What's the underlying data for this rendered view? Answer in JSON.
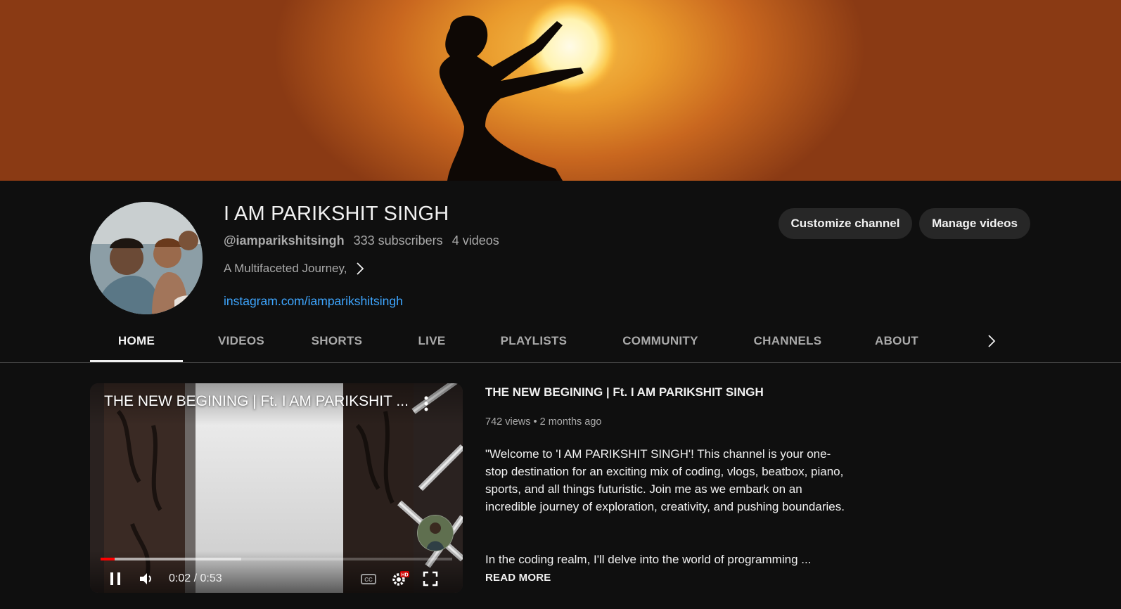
{
  "channel": {
    "name": "I AM PARIKSHIT SINGH",
    "handle": "@iamparikshitsingh",
    "subscribers": "333 subscribers",
    "videos": "4 videos",
    "tagline": "A Multifaceted Journey,",
    "link": "instagram.com/iamparikshitsingh"
  },
  "actions": {
    "customize": "Customize channel",
    "manage": "Manage videos"
  },
  "tabs": [
    {
      "label": "HOME",
      "active": true
    },
    {
      "label": "VIDEOS"
    },
    {
      "label": "SHORTS"
    },
    {
      "label": "LIVE"
    },
    {
      "label": "PLAYLISTS"
    },
    {
      "label": "COMMUNITY"
    },
    {
      "label": "CHANNELS"
    },
    {
      "label": "ABOUT"
    }
  ],
  "player": {
    "overlay_title": "THE NEW BEGINING | Ft. I AM PARIKSHIT ...",
    "time": "0:02 / 0:53",
    "progress_played": 0.04,
    "progress_buffered": 0.4,
    "hd_badge": "HD",
    "cc_label": "CC"
  },
  "featured": {
    "title": "THE NEW BEGINING | Ft. I AM PARIKSHIT SINGH",
    "stats": "742 views • 2 months ago",
    "description": "\"Welcome to 'I AM PARIKSHIT SINGH'! This channel is your one-stop destination for an exciting mix of coding, vlogs, beatbox, piano, sports, and all things futuristic. Join me as we embark on an incredible journey of exploration, creativity, and pushing boundaries.",
    "description_more": "In the coding realm, I'll delve into the world of programming ...",
    "read_more": "READ MORE"
  },
  "colors": {
    "background": "#0f0f0f",
    "link": "#3ea6ff",
    "progress": "#ff0000",
    "button_bg": "#272727"
  }
}
